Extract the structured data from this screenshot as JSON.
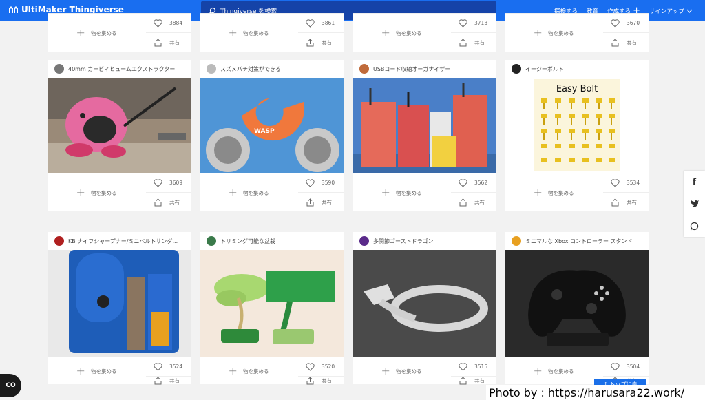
{
  "header": {
    "logo_text": "UltiMaker Thingiverse",
    "search_placeholder": "Thingiverse を検索",
    "nav": {
      "explore": "探検する",
      "education": "教育",
      "create": "作成する",
      "signup": "サインアップ"
    }
  },
  "actions": {
    "collect": "物を集める",
    "share": "共有"
  },
  "top_row": [
    {
      "likes": "3884"
    },
    {
      "likes": "3861"
    },
    {
      "likes": "3713"
    },
    {
      "likes": "3670"
    }
  ],
  "row1": [
    {
      "title": "40mm カービィヒュームエクストラクター",
      "likes": "3609",
      "avatar_color": "#777777"
    },
    {
      "title": "スズメバチ対策ができる",
      "likes": "3590",
      "avatar_color": "#aaaaaa"
    },
    {
      "title": "USBコード収納オーガナイザー",
      "likes": "3562",
      "avatar_color": "#c06a3a"
    },
    {
      "title": "イージーボルト",
      "likes": "3534",
      "avatar_color": "#222222",
      "image_text": "Easy Bolt"
    }
  ],
  "row2": [
    {
      "title": "KB ナイフシャープナー/ミニベルトサンダ...",
      "likes": "3524",
      "avatar_color": "#b02020"
    },
    {
      "title": "トリミング可能な盆栽",
      "likes": "3520",
      "avatar_color": "#3a7a4a"
    },
    {
      "title": "多関節ゴーストドラゴン",
      "likes": "3515",
      "avatar_color": "#5a2a8a"
    },
    {
      "title": "ミニマルな Xbox コントローラー スタンド",
      "likes": "3504",
      "avatar_color": "#e8a020"
    }
  ],
  "image_texts": {
    "wasp": "WASP"
  },
  "social": {
    "facebook": "f",
    "twitter": "t",
    "whatsapp": "w"
  },
  "misc": {
    "cc_button": "CO",
    "to_top": "↑ トップに戻",
    "credit": "Photo by : https://harusara22.work/"
  },
  "colors": {
    "brand": "#196ef0",
    "search_bg": "#1543a8",
    "card_bg": "#ffffff",
    "page_bg": "#f2f2f2"
  }
}
